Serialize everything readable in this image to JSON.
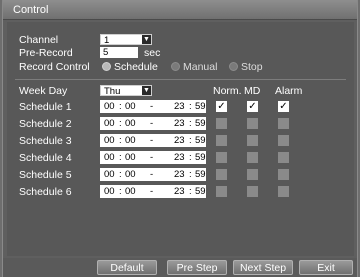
{
  "window": {
    "title": "Control"
  },
  "channel": {
    "label": "Channel",
    "value": "1"
  },
  "prerecord": {
    "label": "Pre-Record",
    "value": "5",
    "unit": "sec"
  },
  "record_control": {
    "label": "Record Control",
    "options": [
      "Schedule",
      "Manual",
      "Stop"
    ],
    "selected": "Schedule"
  },
  "week_day": {
    "label": "Week Day",
    "value": "Thu"
  },
  "columns": {
    "norm": "Norm.",
    "md": "MD",
    "alarm": "Alarm"
  },
  "schedules": [
    {
      "label": "Schedule 1",
      "start_h": "00",
      "start_m": "00",
      "end_h": "23",
      "end_m": "59",
      "norm": true,
      "md": true,
      "alarm": true
    },
    {
      "label": "Schedule 2",
      "start_h": "00",
      "start_m": "00",
      "end_h": "23",
      "end_m": "59",
      "norm": false,
      "md": false,
      "alarm": false
    },
    {
      "label": "Schedule 3",
      "start_h": "00",
      "start_m": "00",
      "end_h": "23",
      "end_m": "59",
      "norm": false,
      "md": false,
      "alarm": false
    },
    {
      "label": "Schedule 4",
      "start_h": "00",
      "start_m": "00",
      "end_h": "23",
      "end_m": "59",
      "norm": false,
      "md": false,
      "alarm": false
    },
    {
      "label": "Schedule 5",
      "start_h": "00",
      "start_m": "00",
      "end_h": "23",
      "end_m": "59",
      "norm": false,
      "md": false,
      "alarm": false
    },
    {
      "label": "Schedule 6",
      "start_h": "00",
      "start_m": "00",
      "end_h": "23",
      "end_m": "59",
      "norm": false,
      "md": false,
      "alarm": false
    }
  ],
  "time_separators": {
    "colon": ":",
    "dash": "-"
  },
  "buttons": {
    "default": "Default",
    "pre_step": "Pre Step",
    "next_step": "Next Step",
    "exit": "Exit"
  }
}
